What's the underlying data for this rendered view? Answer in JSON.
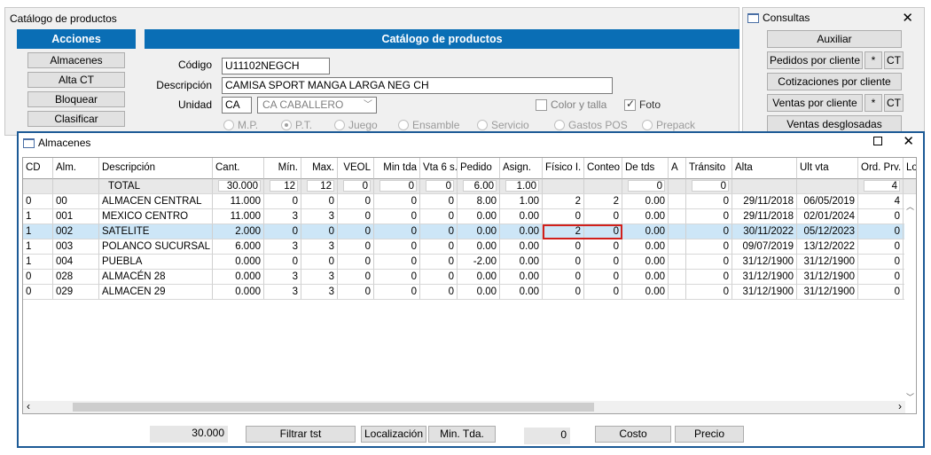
{
  "main": {
    "title": "Catálogo de productos",
    "acciones_header": "Acciones",
    "actions": [
      "Almacenes",
      "Alta CT",
      "Bloquear",
      "Clasificar"
    ],
    "catalog_header": "Catálogo de productos",
    "codigo_label": "Código",
    "codigo_value": "U11102NEGCH",
    "descripcion_label": "Descripción",
    "descripcion_value": "CAMISA SPORT MANGA LARGA NEG CH",
    "unidad_label": "Unidad",
    "unidad_value": "CA",
    "unidad_select": "CA  CABALLERO",
    "color_talla_label": "Color y talla",
    "color_talla_checked": false,
    "foto_label": "Foto",
    "foto_checked": true,
    "radios": [
      "M.P.",
      "P.T.",
      "Juego",
      "Ensamble",
      "Servicio",
      "Gastos POS",
      "Prepack"
    ],
    "radio_selected": "P.T."
  },
  "consultas": {
    "title": "Consultas",
    "close": "✕",
    "auxiliar": "Auxiliar",
    "pedidos_por_cliente": "Pedidos por cliente",
    "pedidos_star": "*",
    "pedidos_ct": "CT",
    "cotizaciones_por_cliente": "Cotizaciones por cliente",
    "ventas_por_cliente": "Ventas por cliente",
    "ventas_star": "*",
    "ventas_ct": "CT",
    "ventas_desglosadas": "Ventas desglosadas"
  },
  "almacenes": {
    "title": "Almacenes",
    "close": "✕",
    "columns": [
      "CD",
      "Alm.",
      "Descripción",
      "Cant.",
      "Mín.",
      "Max.",
      "VEOL",
      "Min tda",
      "Vta 6 s.",
      "Pedido",
      "Asign.",
      "Físico I.",
      "Conteo",
      "De tds",
      "A",
      "Tránsito",
      "Alta",
      "Ult vta",
      "Ord. Prv.",
      "Lo"
    ],
    "total": {
      "label": "TOTAL",
      "cant": "30.000",
      "min": "12",
      "max": "12",
      "veol": "0",
      "min_tda": "0",
      "vta6": "0",
      "pedido": "6.00",
      "asign": "1.00",
      "de_tds": "0",
      "transito": "0",
      "ord_prv": "4"
    },
    "rows": [
      [
        "0",
        "00",
        "ALMACEN CENTRAL",
        "11.000",
        "0",
        "0",
        "0",
        "0",
        "0",
        "8.00",
        "1.00",
        "2",
        "2",
        "0.00",
        "",
        "0",
        "29/11/2018",
        "06/05/2019",
        "4"
      ],
      [
        "1",
        "001",
        "MEXICO CENTRO",
        "11.000",
        "3",
        "3",
        "0",
        "0",
        "0",
        "0.00",
        "0.00",
        "0",
        "0",
        "0.00",
        "",
        "0",
        "29/11/2018",
        "02/01/2024",
        "0"
      ],
      [
        "1",
        "002",
        "SATELITE",
        "2.000",
        "0",
        "0",
        "0",
        "0",
        "0",
        "0.00",
        "0.00",
        "2",
        "0",
        "0.00",
        "",
        "0",
        "30/11/2022",
        "05/12/2023",
        "0"
      ],
      [
        "1",
        "003",
        "POLANCO SUCURSAL",
        "6.000",
        "3",
        "3",
        "0",
        "0",
        "0",
        "0.00",
        "0.00",
        "0",
        "0",
        "0.00",
        "",
        "0",
        "09/07/2019",
        "13/12/2022",
        "0"
      ],
      [
        "1",
        "004",
        "PUEBLA",
        "0.000",
        "0",
        "0",
        "0",
        "0",
        "0",
        "-2.00",
        "0.00",
        "0",
        "0",
        "0.00",
        "",
        "0",
        "31/12/1900",
        "31/12/1900",
        "0"
      ],
      [
        "0",
        "028",
        "ALMACÉN 28",
        "0.000",
        "3",
        "3",
        "0",
        "0",
        "0",
        "0.00",
        "0.00",
        "0",
        "0",
        "0.00",
        "",
        "0",
        "31/12/1900",
        "31/12/1900",
        "0"
      ],
      [
        "0",
        "029",
        "ALMACEN 29",
        "0.000",
        "3",
        "3",
        "0",
        "0",
        "0",
        "0.00",
        "0.00",
        "0",
        "0",
        "0.00",
        "",
        "0",
        "31/12/1900",
        "31/12/1900",
        "0"
      ]
    ],
    "selected_row": 2,
    "bottom": {
      "total_value": "30.000",
      "filtrar": "Filtrar  tst",
      "localizacion": "Localización",
      "min_tda": "Min. Tda.",
      "zero_value": "0",
      "costo": "Costo",
      "precio": "Precio"
    }
  },
  "colors": {
    "accent": "#0a6eb5",
    "selected_row": "#cde6f7",
    "highlight": "#d0201c"
  }
}
